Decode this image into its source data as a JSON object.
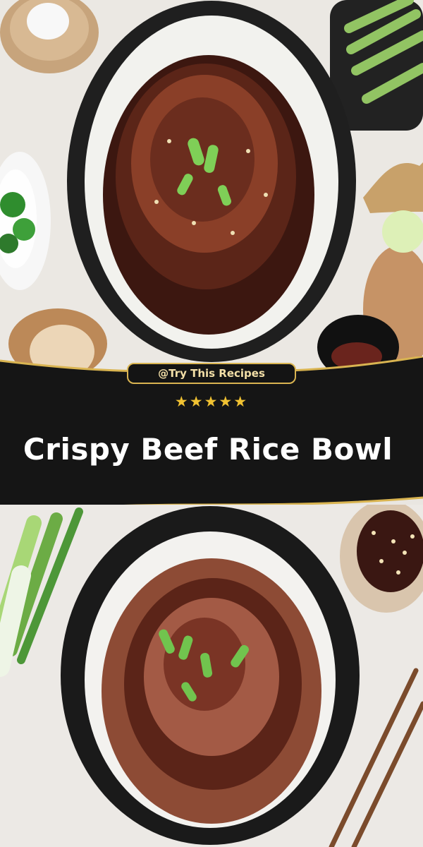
{
  "banner": {
    "tag": "@Try This Recipes",
    "stars": "★★★★★",
    "title": "Crispy Beef Rice Bowl"
  },
  "photos": {
    "top": "beef-rice-bowl-top-photo",
    "bottom": "sliced-beef-rice-bowl-photo"
  },
  "colors": {
    "banner_bg": "#151515",
    "gold": "#d9b451",
    "title": "#ffffff",
    "star": "#f1c232"
  }
}
